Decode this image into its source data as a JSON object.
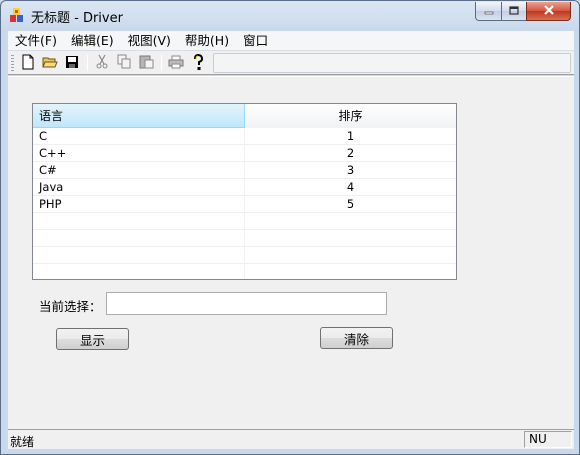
{
  "window": {
    "title": "无标题 - Driver",
    "icon": "mfc-app-icon"
  },
  "menubar": {
    "items": [
      {
        "label": "文件(F)"
      },
      {
        "label": "编辑(E)"
      },
      {
        "label": "视图(V)"
      },
      {
        "label": "帮助(H)"
      },
      {
        "label": "窗口"
      }
    ]
  },
  "toolbar": {
    "buttons": [
      "new-file-icon",
      "open-folder-icon",
      "save-icon",
      "cut-icon",
      "copy-icon",
      "paste-icon",
      "print-icon",
      "help-icon"
    ]
  },
  "list": {
    "columns": [
      "语言",
      "排序"
    ],
    "rows": [
      {
        "lang": "C",
        "order": "1"
      },
      {
        "lang": "C++",
        "order": "2"
      },
      {
        "lang": "C#",
        "order": "3"
      },
      {
        "lang": "Java",
        "order": "4"
      },
      {
        "lang": "PHP",
        "order": "5"
      }
    ]
  },
  "selection": {
    "label": "当前选择：",
    "value": ""
  },
  "buttons": {
    "show": "显示",
    "clear": "清除"
  },
  "statusbar": {
    "text": "就绪",
    "indicator": "NU"
  },
  "colors": {
    "header_selected": "#bfe7f9",
    "close_button": "#c1361d"
  }
}
